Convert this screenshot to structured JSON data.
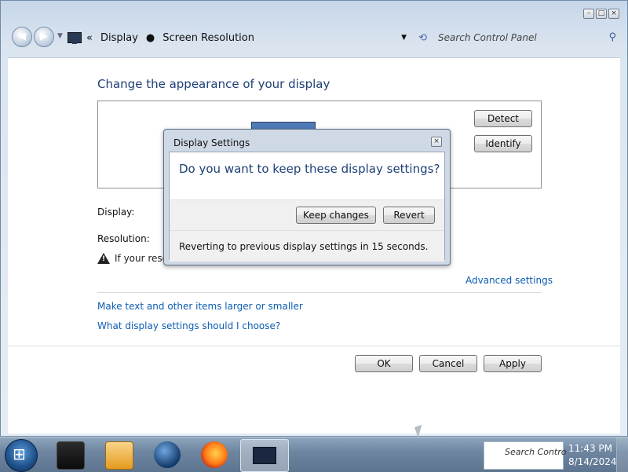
{
  "window": {
    "breadcrumb": [
      "Display",
      "Screen Resolution"
    ],
    "breadcrumb_prefix": "«",
    "search_placeholder": "Search Control Panel"
  },
  "content": {
    "heading": "Change the appearance of your display",
    "detect_label": "Detect",
    "identify_label": "Identify",
    "display_label": "Display:",
    "resolution_label": "Resolution:",
    "warning_text": "If your resol",
    "advanced_link": "Advanced settings",
    "link_text_size": "Make text and other items larger or smaller",
    "link_help": "What display settings should I choose?",
    "ok_label": "OK",
    "cancel_label": "Cancel",
    "apply_label": "Apply"
  },
  "dialog": {
    "title": "Display Settings",
    "question": "Do you want to keep these display settings?",
    "keep_label": "Keep changes",
    "revert_label": "Revert",
    "message": "Reverting to previous display settings in 15 seconds."
  },
  "taskbar": {
    "search_text": "Search Contro",
    "time": "11:43 PM",
    "date": "8/14/2024"
  },
  "colors": {
    "heading": "#1e3f75",
    "link": "#0c5cb3"
  }
}
